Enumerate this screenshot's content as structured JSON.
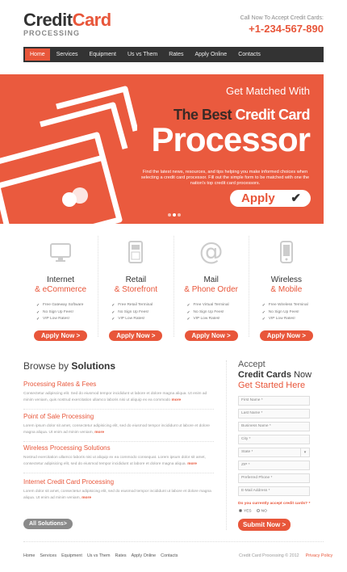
{
  "brand": {
    "word1": "Credit",
    "word2": "Card",
    "sub": "PROCESSING"
  },
  "callus": {
    "label": "Call Now To Accept Credit Cards:",
    "phone": "+1-234-567-890"
  },
  "nav": [
    "Home",
    "Services",
    "Equipment",
    "Us vs Them",
    "Rates",
    "Apply Online",
    "Contacts"
  ],
  "hero": {
    "line1": "Get Matched With",
    "line2a": "The Best ",
    "line2b": "Credit Card",
    "line3": "Processor",
    "desc": "Find the latest news, resources, and tips helping you make informed choices when selecting a credit card processor. Fill out the simple form to be matched with one the nation's top credit card processors.",
    "button": "Apply"
  },
  "services": [
    {
      "icon": "monitor-icon",
      "t1": "Internet",
      "t2": "& eCommerce",
      "items": [
        "Free Gateway Software",
        "No Sign Up Fees!",
        "VIP Low Rates!"
      ],
      "btn": "Apply Now >"
    },
    {
      "icon": "pos-terminal-icon",
      "t1": "Retail",
      "t2": "& Storefront",
      "items": [
        "Free Retail Terminal",
        "No Sign Up Fees!",
        "VIP Low Rates!"
      ],
      "btn": "Apply Now >"
    },
    {
      "icon": "at-sign-icon",
      "t1": "Mail",
      "t2": "& Phone Order",
      "items": [
        "Free Virtual Terminal",
        "No Sign Up Fees!",
        "VIP Low Rates!"
      ],
      "btn": "Apply Now >"
    },
    {
      "icon": "mobile-phone-icon",
      "t1": "Wireless",
      "t2": "& Mobile",
      "items": [
        "Free Wireless Terminal",
        "No Sign Up Fees!",
        "VIP Low Rates!"
      ],
      "btn": "Apply Now >"
    }
  ],
  "browse": {
    "title_a": "Browse by ",
    "title_b": "Solutions",
    "items": [
      {
        "title": "Processing Rates & Fees",
        "desc": "Consectetur adipiscing elit. Sed do eiusmod tempor incididunt ut labore et dolore magna aliqua. Ut enim ad minim veniam, quis nostrud exercitation ullamco laboris nisi ut aliquip ex ea commodo",
        "more": "more"
      },
      {
        "title": "Point of Sale Processing",
        "desc": "Lorem ipsum dolor sit amet, consectetur adipisicing elit, sed do eiusmod tempor incididunt ut labore et dolore magna aliqua. Ut enim ad minim veniam,",
        "more": "more"
      },
      {
        "title": "Wireless Processing Solutions",
        "desc": "Nostrud exercitation ullamco laboris nisi ut aliquip ex ea commodo consequat. Lorem ipsum dolor sit amet, consectetur adipisicing elit, sed do eiusmod tempor incididunt ut labore et dolore magna aliqua.",
        "more": "more"
      },
      {
        "title": "Internet Credit Card Processing",
        "desc": "Lorem dolor sit amet, consectetur adipisicing elit, sed do eiusmod tempor incididunt ut labore et dolore magna aliqua. Ut enim ad minim veniam,",
        "more": "more"
      }
    ],
    "all_button": "All Solutions>"
  },
  "form": {
    "h1": "Accept",
    "h2a": "Credit Cards",
    "h2b": " Now",
    "h3": "Get Started Here",
    "fields": [
      "First Name *",
      "Last Name *",
      "Business Name *",
      "City *",
      "State *",
      "ZIP *",
      "Preferred Phone *",
      "E-Mail Address *"
    ],
    "question": "Do you currently accept credit cards? *",
    "yes": "YES",
    "no": "NO",
    "submit": "Submit Now >"
  },
  "footer": {
    "links": [
      "Home",
      "Services",
      "Equipment",
      "Us vs Them",
      "Rates",
      "Apply Online",
      "Contacts"
    ],
    "copyright": "Credit Card Processing © 2012",
    "privacy": "Privacy Policy"
  },
  "colors": {
    "accent": "#e8563a",
    "dark": "#333333"
  }
}
